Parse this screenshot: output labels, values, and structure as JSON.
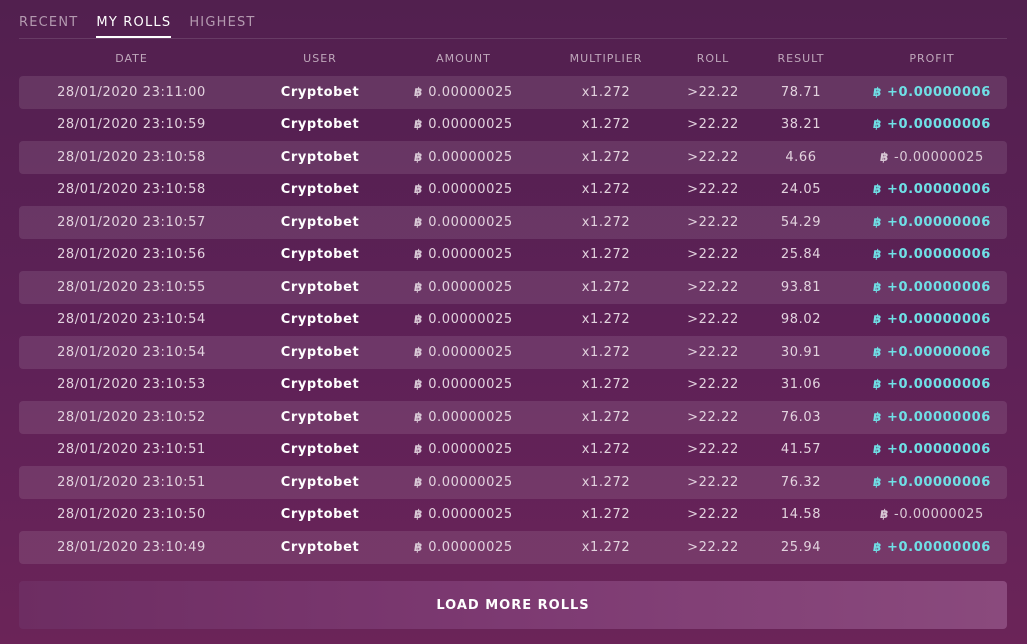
{
  "tabs": [
    {
      "label": "RECENT",
      "active": false
    },
    {
      "label": "MY ROLLS",
      "active": true
    },
    {
      "label": "HIGHEST",
      "active": false
    }
  ],
  "columns": [
    "DATE",
    "USER",
    "AMOUNT",
    "MULTIPLIER",
    "ROLL",
    "RESULT",
    "PROFIT"
  ],
  "currency_glyph": "฿",
  "colors": {
    "win": "#6fe0e6",
    "loss": "#d9c9d6"
  },
  "rolls": [
    {
      "date": "28/01/2020 23:11:00",
      "user": "Cryptobet",
      "amount": "0.00000025",
      "multiplier": "x1.272",
      "roll": ">22.22",
      "result": "78.71",
      "profit": "+0.00000006",
      "win": true
    },
    {
      "date": "28/01/2020 23:10:59",
      "user": "Cryptobet",
      "amount": "0.00000025",
      "multiplier": "x1.272",
      "roll": ">22.22",
      "result": "38.21",
      "profit": "+0.00000006",
      "win": true
    },
    {
      "date": "28/01/2020 23:10:58",
      "user": "Cryptobet",
      "amount": "0.00000025",
      "multiplier": "x1.272",
      "roll": ">22.22",
      "result": "4.66",
      "profit": "-0.00000025",
      "win": false
    },
    {
      "date": "28/01/2020 23:10:58",
      "user": "Cryptobet",
      "amount": "0.00000025",
      "multiplier": "x1.272",
      "roll": ">22.22",
      "result": "24.05",
      "profit": "+0.00000006",
      "win": true
    },
    {
      "date": "28/01/2020 23:10:57",
      "user": "Cryptobet",
      "amount": "0.00000025",
      "multiplier": "x1.272",
      "roll": ">22.22",
      "result": "54.29",
      "profit": "+0.00000006",
      "win": true
    },
    {
      "date": "28/01/2020 23:10:56",
      "user": "Cryptobet",
      "amount": "0.00000025",
      "multiplier": "x1.272",
      "roll": ">22.22",
      "result": "25.84",
      "profit": "+0.00000006",
      "win": true
    },
    {
      "date": "28/01/2020 23:10:55",
      "user": "Cryptobet",
      "amount": "0.00000025",
      "multiplier": "x1.272",
      "roll": ">22.22",
      "result": "93.81",
      "profit": "+0.00000006",
      "win": true
    },
    {
      "date": "28/01/2020 23:10:54",
      "user": "Cryptobet",
      "amount": "0.00000025",
      "multiplier": "x1.272",
      "roll": ">22.22",
      "result": "98.02",
      "profit": "+0.00000006",
      "win": true
    },
    {
      "date": "28/01/2020 23:10:54",
      "user": "Cryptobet",
      "amount": "0.00000025",
      "multiplier": "x1.272",
      "roll": ">22.22",
      "result": "30.91",
      "profit": "+0.00000006",
      "win": true
    },
    {
      "date": "28/01/2020 23:10:53",
      "user": "Cryptobet",
      "amount": "0.00000025",
      "multiplier": "x1.272",
      "roll": ">22.22",
      "result": "31.06",
      "profit": "+0.00000006",
      "win": true
    },
    {
      "date": "28/01/2020 23:10:52",
      "user": "Cryptobet",
      "amount": "0.00000025",
      "multiplier": "x1.272",
      "roll": ">22.22",
      "result": "76.03",
      "profit": "+0.00000006",
      "win": true
    },
    {
      "date": "28/01/2020 23:10:51",
      "user": "Cryptobet",
      "amount": "0.00000025",
      "multiplier": "x1.272",
      "roll": ">22.22",
      "result": "41.57",
      "profit": "+0.00000006",
      "win": true
    },
    {
      "date": "28/01/2020 23:10:51",
      "user": "Cryptobet",
      "amount": "0.00000025",
      "multiplier": "x1.272",
      "roll": ">22.22",
      "result": "76.32",
      "profit": "+0.00000006",
      "win": true
    },
    {
      "date": "28/01/2020 23:10:50",
      "user": "Cryptobet",
      "amount": "0.00000025",
      "multiplier": "x1.272",
      "roll": ">22.22",
      "result": "14.58",
      "profit": "-0.00000025",
      "win": false
    },
    {
      "date": "28/01/2020 23:10:49",
      "user": "Cryptobet",
      "amount": "0.00000025",
      "multiplier": "x1.272",
      "roll": ">22.22",
      "result": "25.94",
      "profit": "+0.00000006",
      "win": true
    }
  ],
  "load_more_label": "LOAD MORE ROLLS"
}
